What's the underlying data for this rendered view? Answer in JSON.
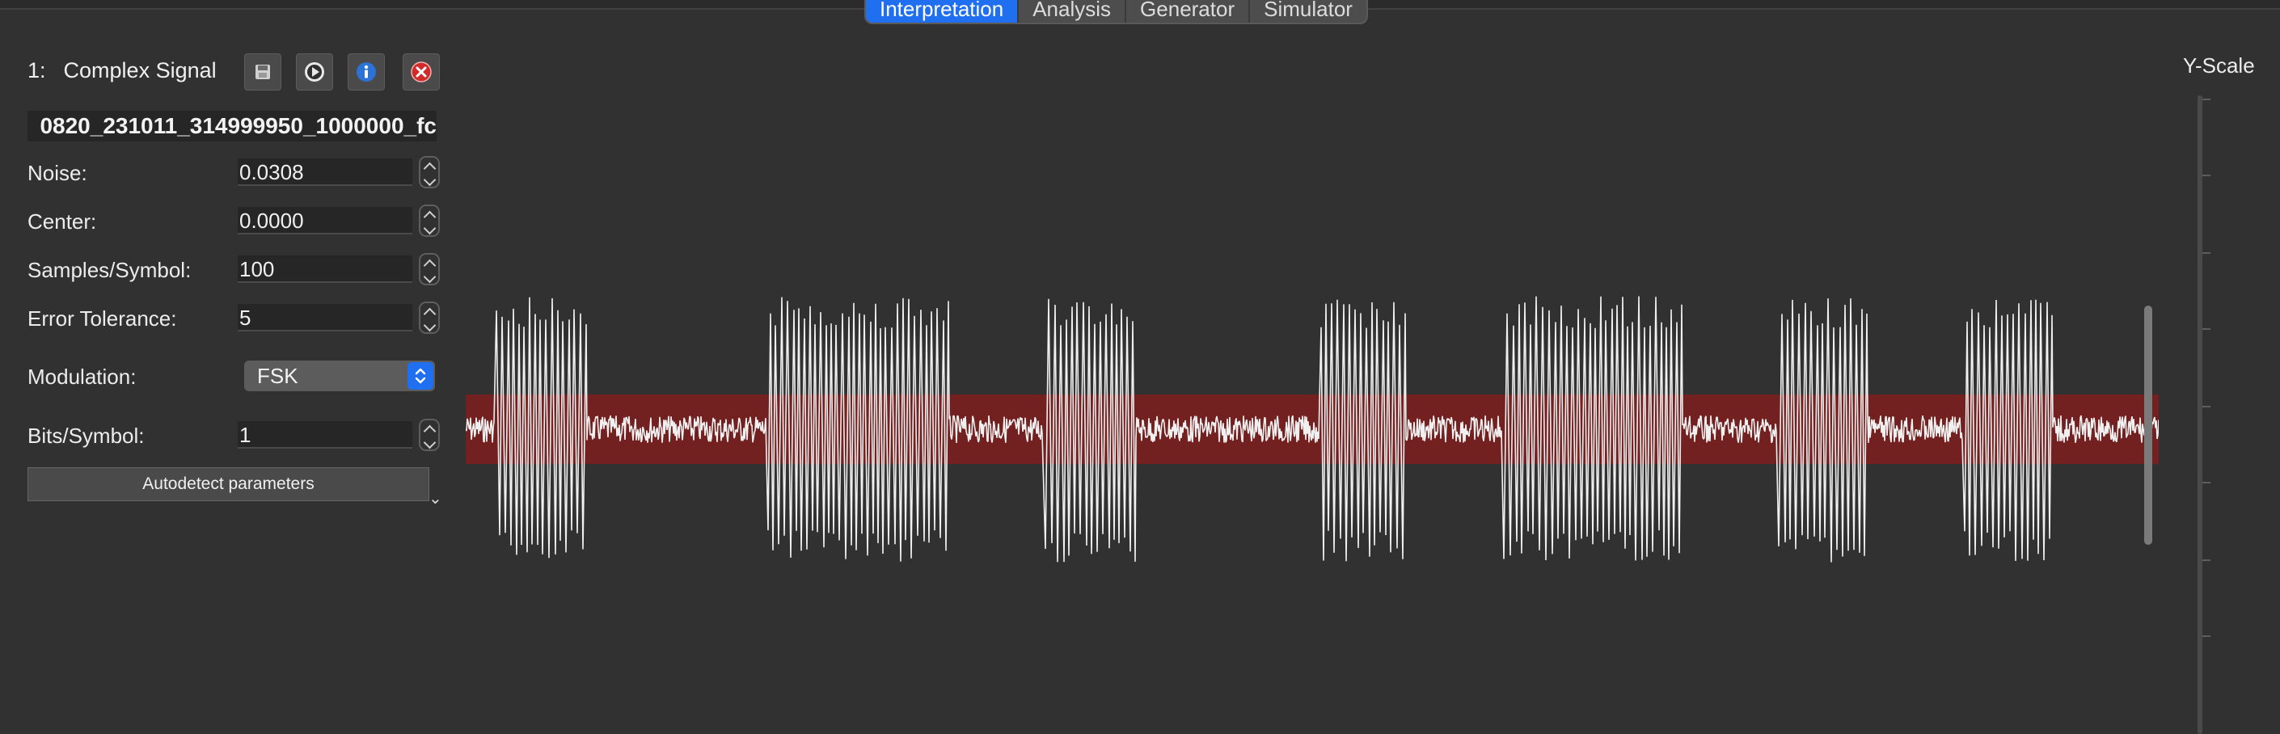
{
  "tabs": [
    {
      "label": "Interpretation",
      "active": true
    },
    {
      "label": "Analysis"
    },
    {
      "label": "Generator"
    },
    {
      "label": "Simulator"
    }
  ],
  "signal_panel": {
    "index": "1:",
    "title": "Complex Signal",
    "toolbar_icons": [
      "save-icon",
      "play-icon",
      "info-icon",
      "close-icon"
    ],
    "filename": "0820_231011_314999950_1000000_fc",
    "fields": {
      "noise": {
        "label": "Noise:",
        "value": "0.0308"
      },
      "center": {
        "label": "Center:",
        "value": "0.0000"
      },
      "samples_per_symbol": {
        "label": "Samples/Symbol:",
        "value": "100"
      },
      "error_tolerance": {
        "label": "Error Tolerance:",
        "value": "5"
      },
      "modulation": {
        "label": "Modulation:",
        "value": "FSK"
      },
      "bits_per_symbol": {
        "label": "Bits/Symbol:",
        "value": "1"
      }
    },
    "autodetect_label": "Autodetect parameters"
  },
  "y_scale": {
    "label": "Y-Scale"
  },
  "colors": {
    "accent": "#1f6ff0",
    "noise_band": "#7a1f1f",
    "waveform": "#f0f0f0",
    "background": "#313131"
  }
}
